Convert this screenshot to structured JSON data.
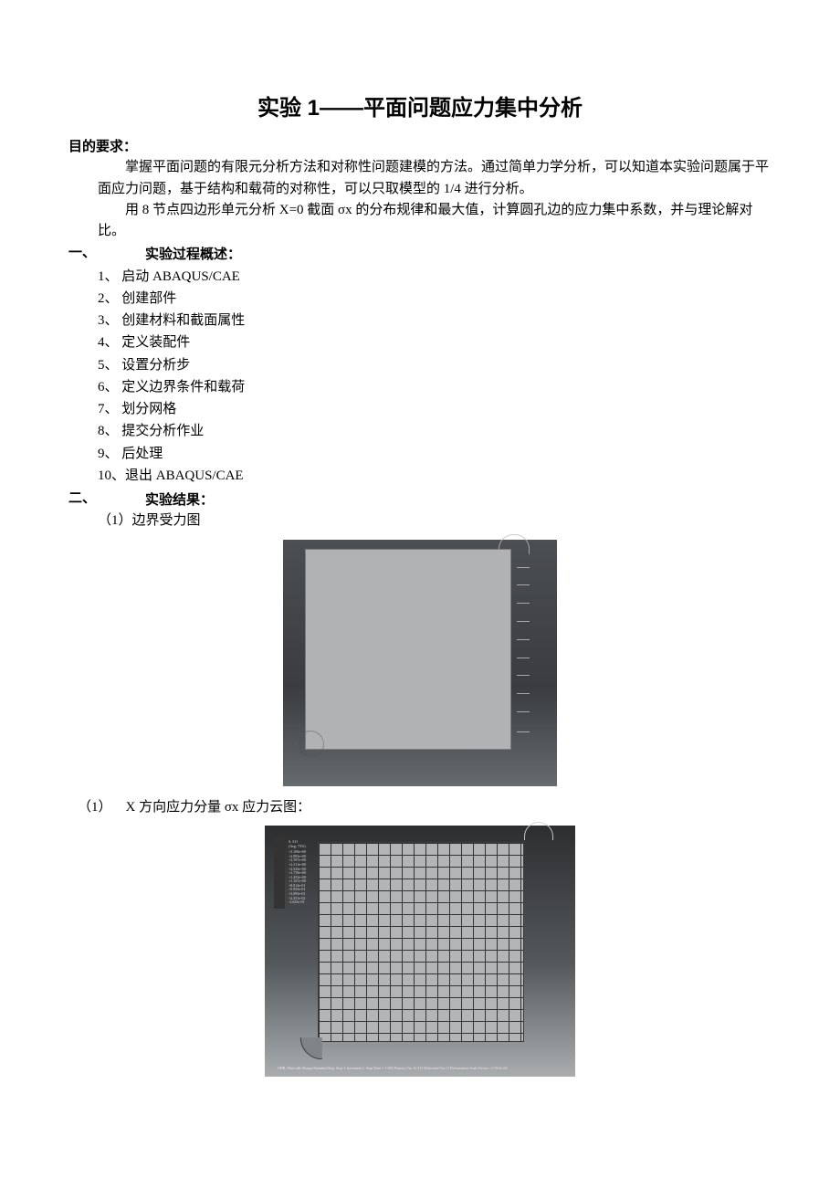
{
  "title": "实验 1——平面问题应力集中分析",
  "objective": {
    "heading": "目的要求：",
    "p1": "掌握平面问题的有限元分析方法和对称性问题建模的方法。通过简单力学分析，可以知道本实验问题属于平面应力问题，基于结构和载荷的对称性，可以只取模型的 1/4 进行分析。",
    "p2": "用 8 节点四边形单元分析 X=0 截面 σx 的分布规律和最大值，计算圆孔边的应力集中系数，并与理论解对比。"
  },
  "section1": {
    "num": "一、",
    "heading": "实验过程概述：",
    "steps": [
      "1、 启动 ABAQUS/CAE",
      "2、 创建部件",
      "3、 创建材料和截面属性",
      "4、 定义装配件",
      "5、 设置分析步",
      "6、 定义边界条件和载荷",
      "7、 划分网格",
      "8、 提交分析作业",
      "9、 后处理",
      "10、退出 ABAQUS/CAE"
    ]
  },
  "section2": {
    "num": "二、",
    "heading": "实验结果：",
    "item1": "（1）边界受力图",
    "item2_num": "（1）",
    "item2_text": "X 方向应力分量 σx 应力云图："
  },
  "fig2_legend": {
    "header": "S, S11\n(Avg: 75%)",
    "values": [
      "+3.169e+00",
      "+2.883e+00",
      "+2.597e+00",
      "+2.311e+00",
      "+2.025e+00",
      "+1.739e+00",
      "+1.453e+00",
      "+1.167e+00",
      "+8.814e-01",
      "+5.955e-01",
      "+3.095e-01",
      "+2.351e-02",
      "-2.625e-01"
    ],
    "footer": "ODB: Plate.odb  Abaqus/Standard  Step: Step-1  Increment 1: Step Time = 1.000  Primary Var: S, S11  Deformed Var: U  Deformation Scale Factor: +1.913e+02"
  }
}
